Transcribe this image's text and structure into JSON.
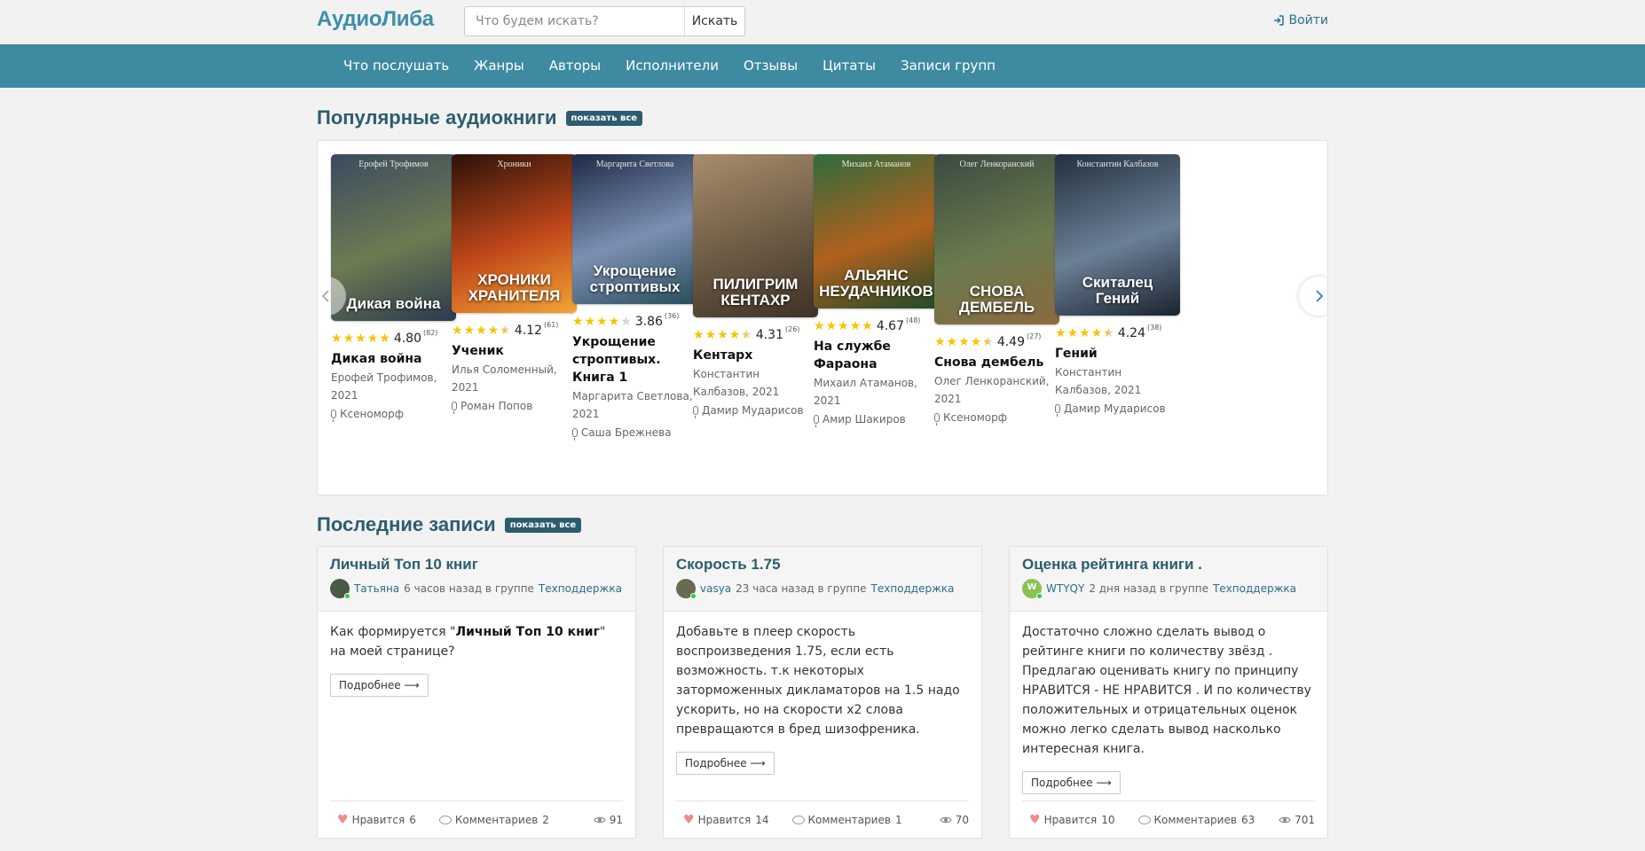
{
  "header": {
    "logo": "АудиоЛиба",
    "search_placeholder": "Что будем искать?",
    "search_button": "Искать",
    "login": "Войти"
  },
  "nav": [
    "Что послушать",
    "Жанры",
    "Авторы",
    "Исполнители",
    "Отзывы",
    "Цитаты",
    "Записи групп"
  ],
  "popular": {
    "title": "Популярные аудиокниги",
    "show_all": "показать все",
    "books": [
      {
        "cover_top": "Ерофей Трофимов",
        "cover_title": "Дикая война",
        "stars": [
          1,
          1,
          1,
          1,
          1
        ],
        "rating": "4.80",
        "count": "(82)",
        "title": "Дикая война",
        "author": "Ерофей Трофимов, 2021",
        "narrator": "Ксеноморф",
        "colors": [
          "#3a4a5e",
          "#6d7b52",
          "#2b3a4e"
        ]
      },
      {
        "cover_top": "Хроники",
        "cover_title": "ХРОНИКИ ХРАНИТЕЛЯ",
        "stars": [
          1,
          1,
          1,
          1,
          0.5
        ],
        "rating": "4.12",
        "count": "(61)",
        "title": "Ученик",
        "author": "Илья Соломенный, 2021",
        "narrator": "Роман Попов",
        "colors": [
          "#2a1208",
          "#c0471a",
          "#f2a535"
        ]
      },
      {
        "cover_top": "Маргарита Светлова",
        "cover_title": "Укрощение строптивых",
        "stars": [
          1,
          1,
          1,
          1,
          0
        ],
        "rating": "3.86",
        "count": "(36)",
        "title": "Укрощение строптивых. Книга 1",
        "author": "Маргарита Светлова, 2021",
        "narrator": "Саша Брежнева",
        "colors": [
          "#1d2a45",
          "#7c8fb3",
          "#294d5a"
        ]
      },
      {
        "cover_top": "",
        "cover_title": "ПИЛИГРИМ КЕНТАХР",
        "stars": [
          1,
          1,
          1,
          1,
          0.5
        ],
        "rating": "4.31",
        "count": "(26)",
        "title": "Кентарх",
        "author": "Константин Калбазов, 2021",
        "narrator": "Дамир Мударисов",
        "colors": [
          "#a88d6a",
          "#6b5a44",
          "#3e3226"
        ]
      },
      {
        "cover_top": "Михаил Атаманов",
        "cover_title": "АЛЬЯНС НЕУДАЧНИКОВ",
        "stars": [
          1,
          1,
          1,
          1,
          1
        ],
        "rating": "4.67",
        "count": "(48)",
        "title": "На службе Фараона",
        "author": "Михаил Атаманов, 2021",
        "narrator": "Амир Шакиров",
        "colors": [
          "#2f6b3c",
          "#b0611e",
          "#1e4a2a"
        ]
      },
      {
        "cover_top": "Олег Ленкоранский",
        "cover_title": "СНОВА ДЕМБЕЛЬ",
        "stars": [
          1,
          1,
          1,
          1,
          0.5
        ],
        "rating": "4.49",
        "count": "(27)",
        "title": "Снова дембель",
        "author": "Олег Ленкоранский, 2021",
        "narrator": "Ксеноморф",
        "colors": [
          "#3a4a40",
          "#6a7a4e",
          "#8b6a3e"
        ]
      },
      {
        "cover_top": "Константин Калбазов",
        "cover_title": "Скиталец Гений",
        "stars": [
          1,
          1,
          1,
          1,
          0.5
        ],
        "rating": "4.24",
        "count": "(38)",
        "title": "Гений",
        "author": "Константин Калбазов, 2021",
        "narrator": "Дамир Мударисов",
        "colors": [
          "#22303e",
          "#6b7f95",
          "#1a2430"
        ]
      }
    ]
  },
  "latest": {
    "title": "Последние записи",
    "show_all": "показать все",
    "posts": [
      {
        "title": "Личный Топ 10 книг",
        "user": "Татьяна",
        "time": "6 часов назад в группе",
        "group": "Техподдержка",
        "avatar_color": "#4a5a48",
        "avatar_letter": "",
        "text_pre": "Как формируется \"",
        "text_bold": "Личный Топ 10 книг",
        "text_post": "\"  на моей странице?",
        "more": "Подробнее ⟶",
        "likes_label": "Нравится",
        "likes": "6",
        "comments_label": "Комментариев",
        "comments": "2",
        "views": "91"
      },
      {
        "title": "Скорость 1.75",
        "user": "vasya",
        "time": "23 часа назад в группе",
        "group": "Техподдержка",
        "avatar_color": "#6a6a50",
        "avatar_letter": "",
        "text_pre": "Добавьте в плеер скорость воспроизведения 1.75, если есть возможность. т.к некоторых заторможенных дикламаторов на 1.5 надо ускорить, но на скорости х2 слова превращаются в бред шизофреника.",
        "text_bold": "",
        "text_post": "",
        "more": "Подробнее ⟶",
        "likes_label": "Нравится",
        "likes": "14",
        "comments_label": "Комментариев",
        "comments": "1",
        "views": "70"
      },
      {
        "title": "Оценка рейтинга книги .",
        "user": "WTYQY",
        "time": "2 дня назад в группе",
        "group": "Техподдержка",
        "avatar_color": "#8cc152",
        "avatar_letter": "W",
        "text_pre": " Достаточно сложно сделать вывод о рейтинге книги по количеству звёзд . Предлагаю оценивать книгу по принципу  НРАВИТСЯ - НЕ НРАВИТСЯ .  И по количеству положительных и отрицательных оценок  можно легко сделать вывод насколько интересная книга.",
        "text_bold": "",
        "text_post": "",
        "more": "Подробнее ⟶",
        "likes_label": "Нравится",
        "likes": "10",
        "comments_label": "Комментариев",
        "comments": "63",
        "views": "701"
      }
    ]
  }
}
